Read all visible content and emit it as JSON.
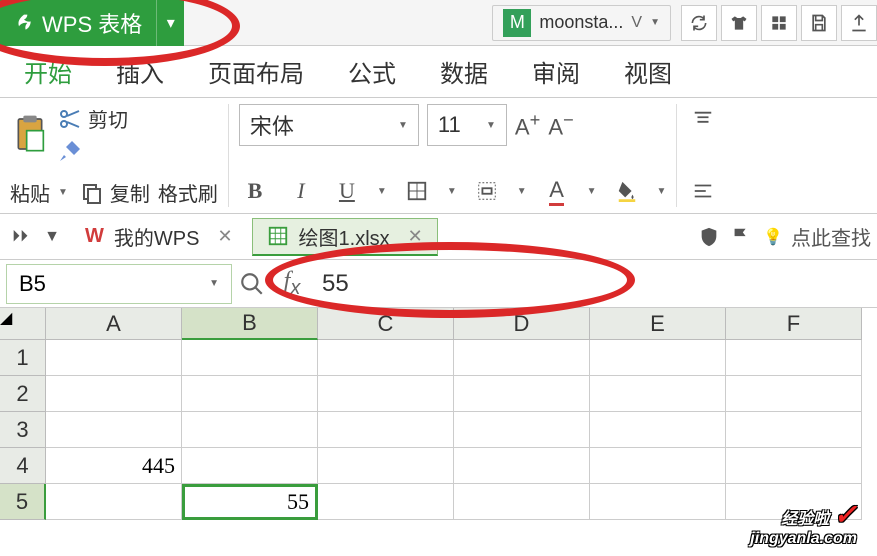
{
  "app": {
    "name": "WPS 表格",
    "user": "moonsta...",
    "user_initial": "M",
    "user_suffix": "V"
  },
  "menu": {
    "tabs": [
      "开始",
      "插入",
      "页面布局",
      "公式",
      "数据",
      "审阅",
      "视图"
    ],
    "active": 0
  },
  "ribbon": {
    "paste": "粘贴",
    "cut": "剪切",
    "copy": "复制",
    "format_painter": "格式刷",
    "font": "宋体",
    "font_size": "11",
    "bold": "B",
    "italic": "I",
    "underline": "U",
    "a_plus": "A⁺",
    "a_minus": "A⁻"
  },
  "doctabs": {
    "mywps": "我的WPS",
    "file": "绘图1.xlsx",
    "hint": "点此查找"
  },
  "formula_bar": {
    "cell_ref": "B5",
    "value": "55"
  },
  "sheet": {
    "cols": [
      "A",
      "B",
      "C",
      "D",
      "E",
      "F"
    ],
    "rows": [
      "1",
      "2",
      "3",
      "4",
      "5"
    ],
    "active": "B5",
    "cells": {
      "A4": "445",
      "B5": "55"
    }
  },
  "watermark": {
    "brand": "经验啦",
    "url": "jingyanla.com",
    "check": "✓"
  }
}
